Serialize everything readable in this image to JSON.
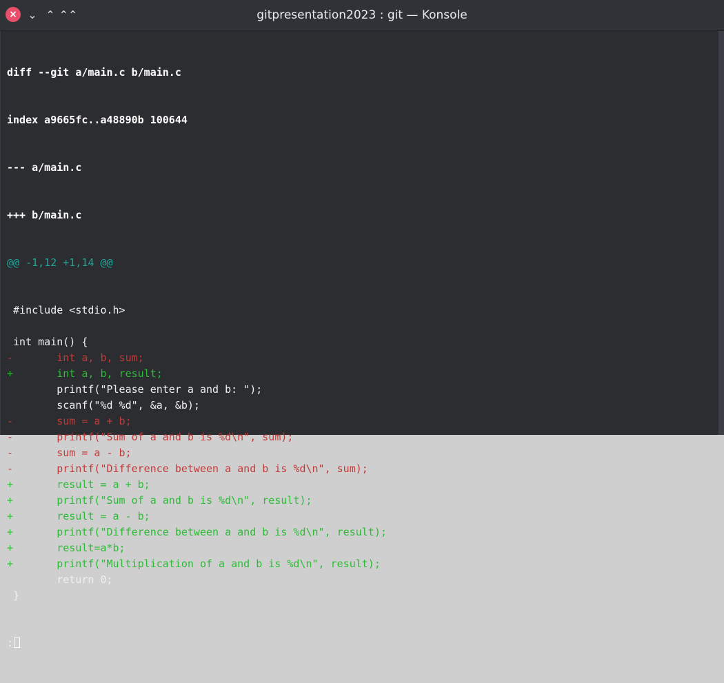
{
  "window": {
    "title": "gitpresentation2023 : git — Konsole"
  },
  "icons": {
    "close": "×",
    "minimize": "⌄",
    "maximize": "⌃",
    "keep_above": "⌃⌃"
  },
  "diff": {
    "header": [
      "diff --git a/main.c b/main.c",
      "index a9665fc..a48890b 100644",
      "--- a/main.c",
      "+++ b/main.c"
    ],
    "hunk": "@@ -1,12 +1,14 @@",
    "lines": [
      {
        "type": "ctx",
        "text": " #include <stdio.h>"
      },
      {
        "type": "ctx",
        "text": ""
      },
      {
        "type": "ctx",
        "text": " int main() {"
      },
      {
        "type": "del",
        "text": "-       int a, b, sum;"
      },
      {
        "type": "add",
        "text": "+       int a, b, result;"
      },
      {
        "type": "ctx",
        "text": "        printf(\"Please enter a and b: \");"
      },
      {
        "type": "ctx",
        "text": "        scanf(\"%d %d\", &a, &b);"
      },
      {
        "type": "del",
        "text": "-       sum = a + b;"
      },
      {
        "type": "del",
        "text": "-       printf(\"Sum of a and b is %d\\n\", sum);"
      },
      {
        "type": "del",
        "text": "-       sum = a - b;"
      },
      {
        "type": "del",
        "text": "-       printf(\"Difference between a and b is %d\\n\", sum);"
      },
      {
        "type": "add",
        "text": "+       result = a + b;"
      },
      {
        "type": "add",
        "text": "+       printf(\"Sum of a and b is %d\\n\", result);"
      },
      {
        "type": "add",
        "text": "+       result = a - b;"
      },
      {
        "type": "add",
        "text": "+       printf(\"Difference between a and b is %d\\n\", result);"
      },
      {
        "type": "add",
        "text": "+       result=a*b;"
      },
      {
        "type": "add",
        "text": "+       printf(\"Multiplication of a and b is %d\\n\", result);"
      },
      {
        "type": "ctx",
        "text": "        return 0;"
      },
      {
        "type": "ctx",
        "text": " }"
      }
    ],
    "prompt": ":"
  },
  "colors": {
    "background": "#2b2d30",
    "titlebar": "#2f3338",
    "hunk": "#1aa79a",
    "deleted": "#c13a3a",
    "added": "#2dbb38",
    "close_button": "#e94f6b"
  }
}
